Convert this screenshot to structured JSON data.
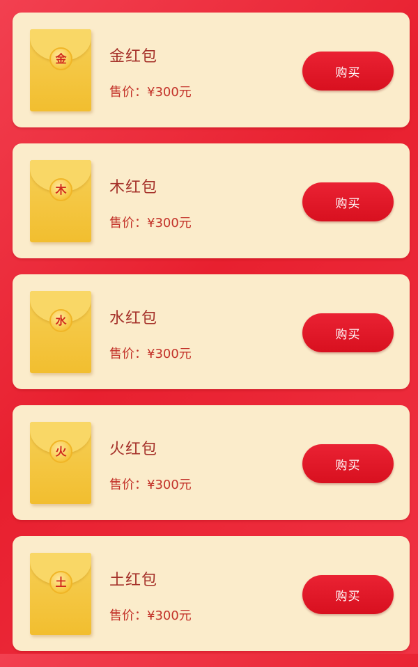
{
  "products": [
    {
      "name": "金红包",
      "price": "售价：¥300元",
      "badge": "金",
      "button": "购买",
      "icon": "red-envelope-icon"
    },
    {
      "name": "木红包",
      "price": "售价：¥300元",
      "badge": "木",
      "button": "购买",
      "icon": "red-envelope-icon"
    },
    {
      "name": "水红包",
      "price": "售价：¥300元",
      "badge": "水",
      "button": "购买",
      "icon": "red-envelope-icon"
    },
    {
      "name": "火红包",
      "price": "售价：¥300元",
      "badge": "火",
      "button": "购买",
      "icon": "red-envelope-icon"
    },
    {
      "name": "土红包",
      "price": "售价：¥300元",
      "badge": "土",
      "button": "购买",
      "icon": "red-envelope-icon"
    }
  ],
  "colors": {
    "background": "#ec2b3a",
    "card": "#fbeccb",
    "button": "#e01a2a",
    "envelope": "#f4c640",
    "text": "#a5312a"
  }
}
